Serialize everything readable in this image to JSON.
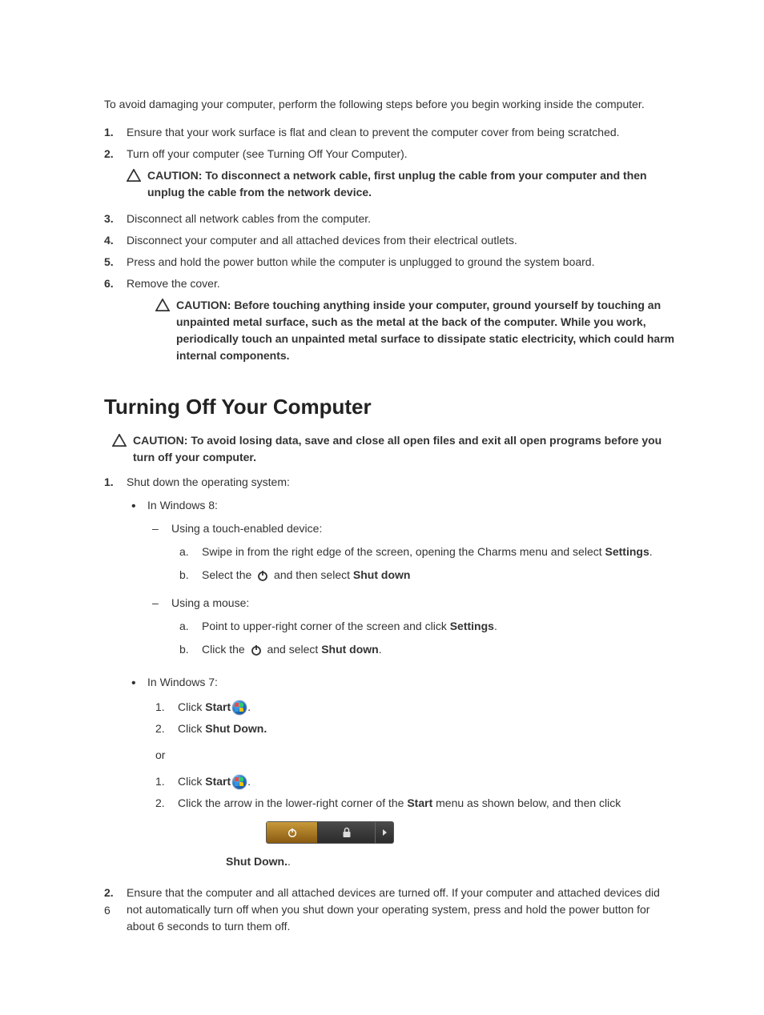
{
  "page_number": "6",
  "intro": "To avoid damaging your computer, perform the following steps before you begin working inside the computer.",
  "list1": {
    "i1": {
      "num": "1.",
      "text": "Ensure that your work surface is flat and clean to prevent the computer cover from being scratched."
    },
    "i2": {
      "num": "2.",
      "text": "Turn off your computer (see Turning Off Your Computer)."
    },
    "caution1": "CAUTION: To disconnect a network cable, first unplug the cable from your computer and then unplug the cable from the network device.",
    "i3": {
      "num": "3.",
      "text": "Disconnect all network cables from the computer."
    },
    "i4": {
      "num": "4.",
      "text": "Disconnect your computer and all attached devices from their electrical outlets."
    },
    "i5": {
      "num": "5.",
      "text": "Press and hold the power button while the computer is unplugged to ground the system board."
    },
    "i6": {
      "num": "6.",
      "text": "Remove the cover."
    },
    "caution2": "CAUTION: Before touching anything inside your computer, ground yourself by touching an unpainted metal surface, such as the metal at the back of the computer. While you work, periodically touch an unpainted metal surface to dissipate static electricity, which could harm internal components."
  },
  "section2": {
    "title": "Turning Off Your Computer",
    "caution": "CAUTION: To avoid losing data, save and close all open files and exit all open programs before you turn off your computer.",
    "step1": {
      "num": "1.",
      "text": "Shut down the operating system:"
    },
    "win8_label": "In Windows 8:",
    "touch_label": "Using a touch-enabled device:",
    "touch_a": {
      "mark": "a.",
      "pre": "Swipe in from the right edge of the screen, opening the Charms menu and select ",
      "bold": "Settings",
      "post": "."
    },
    "touch_b": {
      "mark": "b.",
      "pre": "Select the ",
      "mid": " and then select ",
      "bold": "Shut down"
    },
    "mouse_label": "Using a mouse:",
    "mouse_a": {
      "mark": "a.",
      "pre": "Point to upper-right corner of the screen and click ",
      "bold": "Settings",
      "post": "."
    },
    "mouse_b": {
      "mark": "b.",
      "pre": "Click the ",
      "mid": " and select ",
      "bold": "Shut down",
      "post": "."
    },
    "win7_label": "In Windows 7:",
    "w7a_1": {
      "mark": "1.",
      "pre": "Click ",
      "bold": "Start",
      "post": "."
    },
    "w7a_2": {
      "mark": "2.",
      "pre": "Click ",
      "bold": "Shut Down."
    },
    "or": "or",
    "w7b_1": {
      "mark": "1.",
      "pre": "Click ",
      "bold": "Start",
      "post": "."
    },
    "w7b_2": {
      "mark": "2.",
      "pre": "Click the arrow in the lower-right corner of the ",
      "bold": "Start",
      "post": " menu as shown below, and then click "
    },
    "w7b_2_tail": "Shut Down.",
    "w7b_2_tail2": ".",
    "step2": {
      "num": "2.",
      "text": "Ensure that the computer and all attached devices are turned off. If your computer and attached devices did not automatically turn off when you shut down your operating system, press and hold the power button for about 6 seconds to turn them off."
    }
  }
}
